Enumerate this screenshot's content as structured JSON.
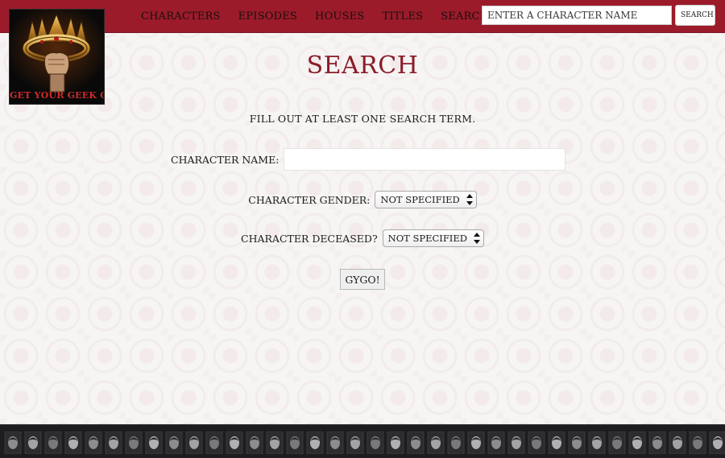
{
  "nav": {
    "links": [
      "CHARACTERS",
      "EPISODES",
      "HOUSES",
      "TITLES",
      "SEARCH"
    ],
    "search_placeholder": "ENTER A CHARACTER NAME",
    "search_button": "SEARCH"
  },
  "logo": {
    "text": "GET YOUR GEEK ON"
  },
  "main": {
    "title": "SEARCH",
    "instruction": "FILL OUT AT LEAST ONE SEARCH TERM.",
    "name_label": "CHARACTER NAME:",
    "name_value": "",
    "gender_label": "CHARACTER GENDER:",
    "gender_selected": "NOT SPECIFIED",
    "deceased_label": "CHARACTER DECEASED?",
    "deceased_selected": "NOT SPECIFIED",
    "submit_label": "GYGO!"
  },
  "colors": {
    "nav_bg": "#9b1b2a",
    "title": "#8a1c28",
    "footer_bg": "#1d1d1f"
  }
}
